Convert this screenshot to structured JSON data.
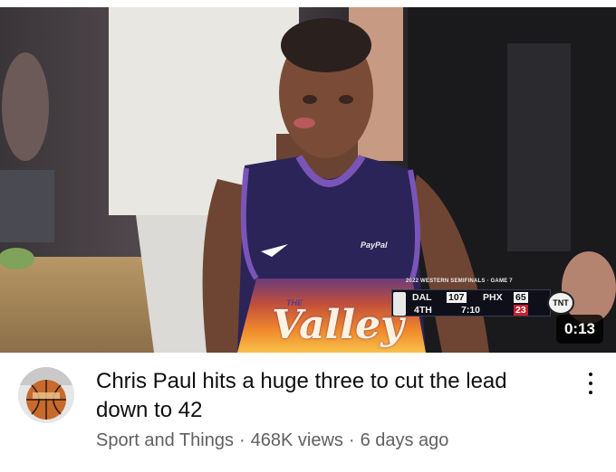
{
  "video": {
    "thumbnail_icon": "basketball-player-thumbnail",
    "duration": "0:13",
    "jersey_sponsor": "PayPal",
    "jersey_wordmark_small": "THE",
    "jersey_wordmark": "Valley",
    "scorebug": {
      "title": "2022 WESTERN SEMIFINALS · GAME 7",
      "away_team": "DAL",
      "away_score": "107",
      "home_team": "PHX",
      "home_score": "65",
      "quarter": "4TH",
      "clock": "7:10",
      "shot_clock": "23",
      "network": "TNT"
    }
  },
  "channel": {
    "avatar_icon": "basketball-avatar-icon",
    "name": "Sport and Things"
  },
  "meta": {
    "title": "Chris Paul hits a huge three to cut the lead down to 42",
    "views": "468K views",
    "separator": "·",
    "age": "6 days ago"
  },
  "menu_icon": "more-vert-icon",
  "colors": {
    "title": "#0f0f0f",
    "meta": "#606060",
    "jersey_purple": "#2b2458",
    "jersey_orange": "#ef7a2a",
    "badge_bg": "#000000"
  }
}
